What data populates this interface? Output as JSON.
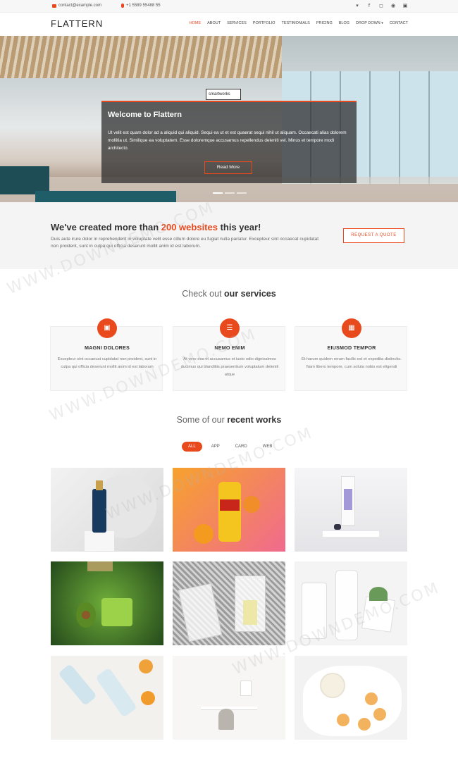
{
  "topbar": {
    "email": "contact@example.com",
    "phone": "+1 5589 55488 55",
    "social_icons": [
      "twitter-icon",
      "facebook-icon",
      "instagram-icon",
      "skype-icon",
      "linkedin-icon"
    ]
  },
  "header": {
    "logo": "FLATTERN",
    "nav": [
      "Home",
      "About",
      "Services",
      "Portfolio",
      "Testimonials",
      "Pricing",
      "Blog",
      "Drop Down",
      "Contact"
    ],
    "active_nav": "Home"
  },
  "hero": {
    "sign": "smartworks",
    "title": "Welcome to Flattern",
    "text": "Ut velit est quam dolor ad a aliquid qui aliquid. Sequi ea ut et est quaerat sequi nihil ut aliquam. Occaecati alias dolorem mollitia ut. Similique ea voluptatem. Esse doloremque accusamus repellendus deleniti vel. Minus et tempore modi architecto.",
    "button": "Read More",
    "slides": 3,
    "active_slide": 1
  },
  "cta": {
    "title_before": "We've created more than ",
    "title_highlight": "200 websites",
    "title_after": " this year!",
    "text": "Duis aute irure dolor in reprehenderit in voluptate velit esse cillum dolore eu fugiat nulla pariatur. Excepteur sint occaecat cupidatat non proident, sunt in culpa qui officia deserunt mollit anim id est laborum.",
    "button": "REQUEST A QUOTE"
  },
  "services": {
    "title_prefix": "Check out ",
    "title_bold": "our services",
    "items": [
      {
        "title": "MAGNI DOLORES",
        "text": "Excepteur sint occaecat cupidatat non proident, sunt in culpa qui officia deserunt mollit anim id est laborum",
        "icon": "image-icon"
      },
      {
        "title": "NEMO ENIM",
        "text": "At vero eos et accusamus et iusto odio dignissimos ducimus qui blanditiis praesentium voluptatum deleniti atque",
        "icon": "sliders-icon"
      },
      {
        "title": "EIUSMOD TEMPOR",
        "text": "Et harum quidem rerum facilis est et expedita distinctio. Nam libero tempore, cum soluta nobis est eligendi",
        "icon": "calendar-icon"
      }
    ]
  },
  "works": {
    "title_prefix": "Some of our ",
    "title_bold": "recent works",
    "filters": [
      "All",
      "App",
      "Card",
      "Web"
    ],
    "active_filter": "All"
  },
  "watermark": "WWW.DOWNDEMO.COM",
  "colors": {
    "accent": "#e8491d"
  }
}
